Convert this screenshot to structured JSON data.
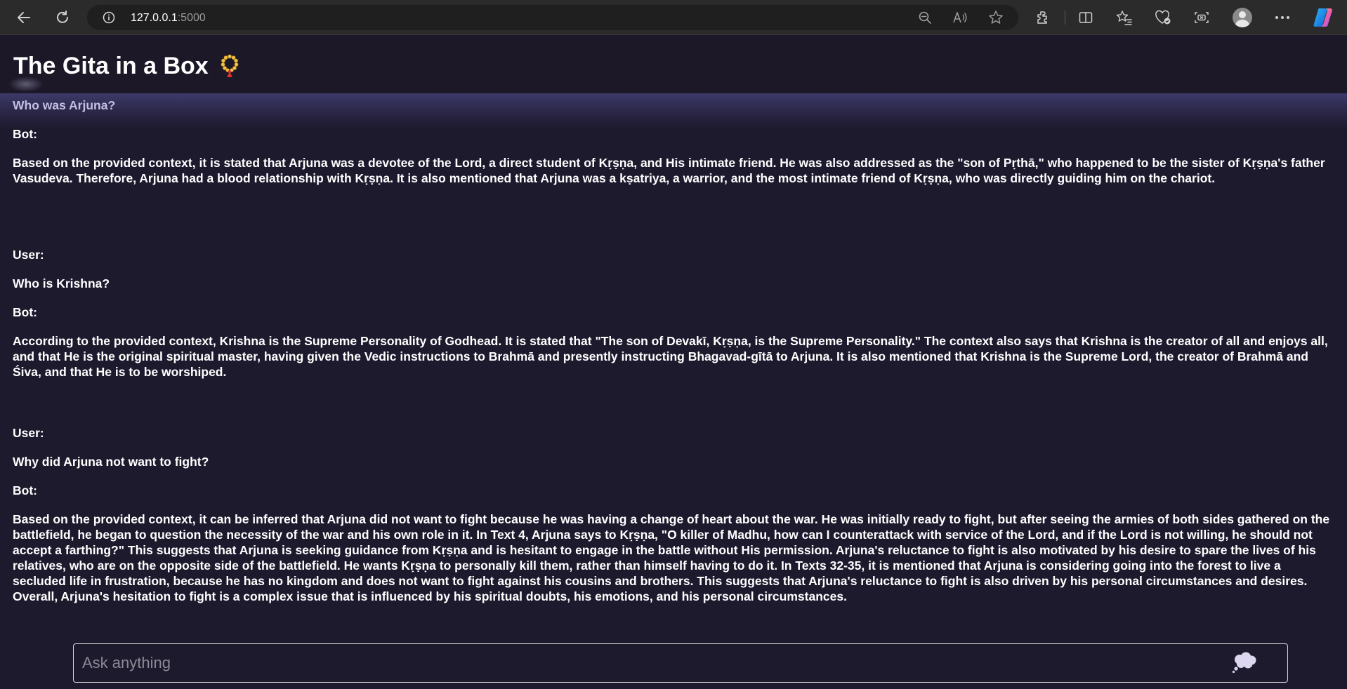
{
  "browser": {
    "url_host": "127.0.0.1",
    "url_port": ":5000"
  },
  "page": {
    "title": "The Gita in a Box"
  },
  "conversation": {
    "first_question": "Who was Arjuna?",
    "bot_label": "Bot:",
    "user_label": "User:",
    "answer_1": "Based on the provided context, it is stated that Arjuna was a devotee of the Lord, a direct student of Kṛṣṇa, and His intimate friend. He was also addressed as the \"son of Pṛthā,\" who happened to be the sister of Kṛṣṇa's father Vasudeva. Therefore, Arjuna had a blood relationship with Kṛṣṇa. It is also mentioned that Arjuna was a kṣatriya, a warrior, and the most intimate friend of Kṛṣṇa, who was directly guiding him on the chariot.",
    "question_2": "Who is Krishna?",
    "answer_2": "According to the provided context, Krishna is the Supreme Personality of Godhead. It is stated that \"The son of Devakī, Kṛṣṇa, is the Supreme Personality.\" The context also says that Krishna is the creator of all and enjoys all, and that He is the original spiritual master, having given the Vedic instructions to Brahmā and presently instructing Bhagavad-gītā to Arjuna. It is also mentioned that Krishna is the Supreme Lord, the creator of Brahmā and Śiva, and that He is to be worshiped.",
    "question_3": "Why did Arjuna not want to fight?",
    "answer_3": "Based on the provided context, it can be inferred that Arjuna did not want to fight because he was having a change of heart about the war. He was initially ready to fight, but after seeing the armies of both sides gathered on the battlefield, he began to question the necessity of the war and his own role in it. In Text 4, Arjuna says to Kṛṣṇa, \"O killer of Madhu, how can I counterattack with service of the Lord, and if the Lord is not willing, he should not accept a farthing?\" This suggests that Arjuna is seeking guidance from Kṛṣṇa and is hesitant to engage in the battle without His permission. Arjuna's reluctance to fight is also motivated by his desire to spare the lives of his relatives, who are on the opposite side of the battlefield. He wants Kṛṣṇa to personally kill them, rather than himself having to do it. In Texts 32-35, it is mentioned that Arjuna is considering going into the forest to live a secluded life in frustration, because he has no kingdom and does not want to fight against his cousins and brothers. This suggests that Arjuna's reluctance to fight is also driven by his personal circumstances and desires. Overall, Arjuna's hesitation to fight is a complex issue that is influenced by his spiritual doubts, his emotions, and his personal circumstances."
  },
  "input": {
    "placeholder": "Ask anything"
  }
}
